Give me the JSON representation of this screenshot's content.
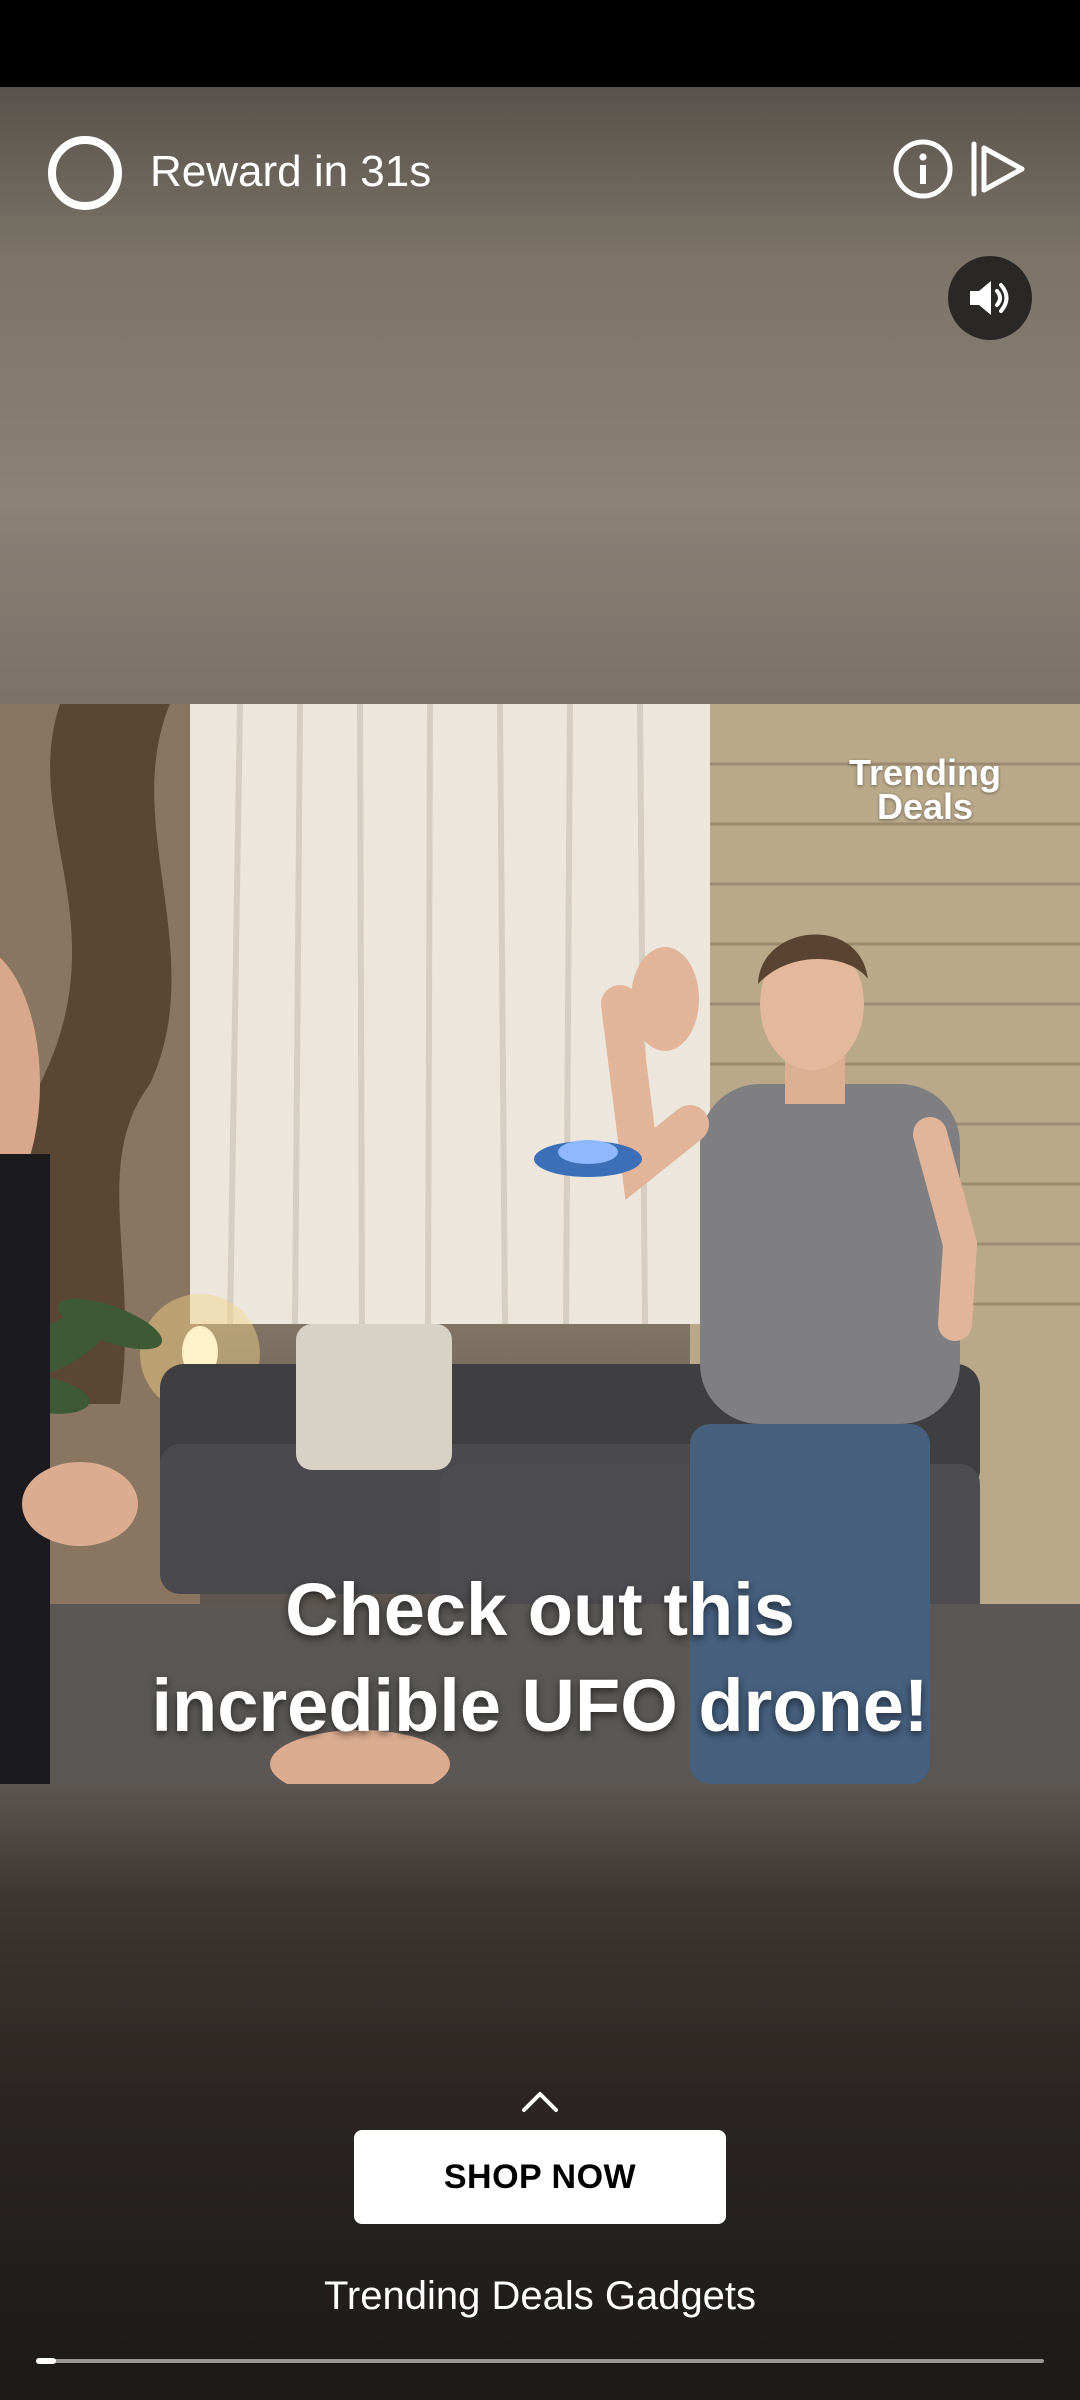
{
  "ad": {
    "reward_label": "Reward in 31s",
    "watermark_line1": "Trending",
    "watermark_line2": "Deals",
    "caption_line1": "Check out this",
    "caption_line2": "incredible UFO drone!",
    "cta_label": "SHOP NOW",
    "advertiser": "Trending Deals Gadgets",
    "progress": 0.02
  },
  "icons": {
    "reward": "reward-ring-icon",
    "info": "info-icon",
    "skip": "skip-icon",
    "sound": "speaker-icon",
    "expand": "chevron-up-icon"
  },
  "colors": {
    "cta_background": "#ffffff",
    "cta_text": "#000000",
    "overlay_text": "#ffffff"
  }
}
